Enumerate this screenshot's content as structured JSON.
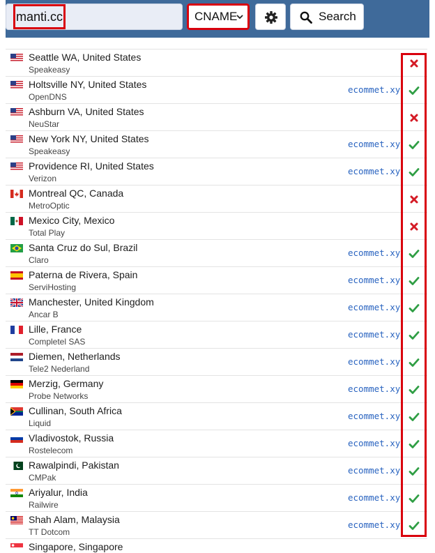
{
  "search": {
    "query": "manti.cc",
    "record_type": "CNAME",
    "button_label": "Search"
  },
  "colors": {
    "header": "#3f6a9a",
    "highlight": "#d9000d",
    "ok": "#2f9e44",
    "fail": "#d41a25",
    "record_text": "#2a64c0"
  },
  "results": [
    {
      "location": "Seattle WA, United States",
      "provider": "Speakeasy",
      "record": "",
      "status": "fail",
      "flag": "us"
    },
    {
      "location": "Holtsville NY, United States",
      "provider": "OpenDNS",
      "record": "ecommet.xyz",
      "status": "ok",
      "flag": "us"
    },
    {
      "location": "Ashburn VA, United States",
      "provider": "NeuStar",
      "record": "",
      "status": "fail",
      "flag": "us"
    },
    {
      "location": "New York NY, United States",
      "provider": "Speakeasy",
      "record": "ecommet.xyz",
      "status": "ok",
      "flag": "us"
    },
    {
      "location": "Providence RI, United States",
      "provider": "Verizon",
      "record": "ecommet.xyz",
      "status": "ok",
      "flag": "us"
    },
    {
      "location": "Montreal QC, Canada",
      "provider": "MetroOptic",
      "record": "",
      "status": "fail",
      "flag": "ca"
    },
    {
      "location": "Mexico City, Mexico",
      "provider": "Total Play",
      "record": "",
      "status": "fail",
      "flag": "mx"
    },
    {
      "location": "Santa Cruz do Sul, Brazil",
      "provider": "Claro",
      "record": "ecommet.xyz",
      "status": "ok",
      "flag": "br"
    },
    {
      "location": "Paterna de Rivera, Spain",
      "provider": "ServiHosting",
      "record": "ecommet.xyz",
      "status": "ok",
      "flag": "es"
    },
    {
      "location": "Manchester, United Kingdom",
      "provider": "Ancar B",
      "record": "ecommet.xyz",
      "status": "ok",
      "flag": "gb"
    },
    {
      "location": "Lille, France",
      "provider": "Completel SAS",
      "record": "ecommet.xyz",
      "status": "ok",
      "flag": "fr"
    },
    {
      "location": "Diemen, Netherlands",
      "provider": "Tele2 Nederland",
      "record": "ecommet.xyz",
      "status": "ok",
      "flag": "nl"
    },
    {
      "location": "Merzig, Germany",
      "provider": "Probe Networks",
      "record": "ecommet.xyz",
      "status": "ok",
      "flag": "de"
    },
    {
      "location": "Cullinan, South Africa",
      "provider": "Liquid",
      "record": "ecommet.xyz",
      "status": "ok",
      "flag": "za"
    },
    {
      "location": "Vladivostok, Russia",
      "provider": "Rostelecom",
      "record": "ecommet.xyz",
      "status": "ok",
      "flag": "ru"
    },
    {
      "location": "Rawalpindi, Pakistan",
      "provider": "CMPak",
      "record": "ecommet.xyz",
      "status": "ok",
      "flag": "pk"
    },
    {
      "location": "Ariyalur, India",
      "provider": "Railwire",
      "record": "ecommet.xyz",
      "status": "ok",
      "flag": "in"
    },
    {
      "location": "Shah Alam, Malaysia",
      "provider": "TT Dotcom",
      "record": "ecommet.xyz",
      "status": "ok",
      "flag": "my"
    },
    {
      "location": "Singapore, Singapore",
      "provider": "",
      "record": "",
      "status": "",
      "flag": "sg"
    }
  ]
}
